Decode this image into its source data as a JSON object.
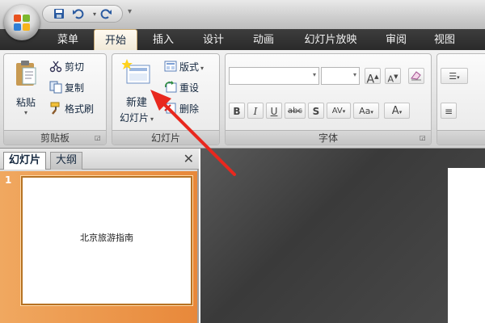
{
  "tabs": [
    "菜单",
    "开始",
    "插入",
    "设计",
    "动画",
    "幻灯片放映",
    "审阅",
    "视图"
  ],
  "active_tab": "开始",
  "clipboard": {
    "paste": "粘贴",
    "cut": "剪切",
    "copy": "复制",
    "format_painter": "格式刷",
    "label": "剪贴板"
  },
  "slides_group": {
    "new_slide_line1": "新建",
    "new_slide_line2": "幻灯片",
    "layout": "版式",
    "reset": "重设",
    "delete": "删除",
    "label": "幻灯片"
  },
  "font_group": {
    "label": "字体",
    "bold": "B",
    "italic": "I",
    "underline": "U",
    "strikethrough": "abc",
    "shadow": "S",
    "spacing": "AV",
    "case": "Aa",
    "color": "A",
    "grow": "A",
    "shrink": "A"
  },
  "panel": {
    "tab_slides": "幻灯片",
    "tab_outline": "大纲",
    "close": "✕"
  },
  "thumbnail": {
    "number": "1",
    "title": "北京旅游指南"
  },
  "colors": {
    "annotation_arrow": "#e8281e",
    "selected_thumbnail": "#e8883a",
    "tab_bar": "#2f2f2f"
  },
  "icons": [
    "office-logo-icon",
    "save-icon",
    "undo-icon",
    "redo-icon",
    "paste-icon",
    "cut-icon",
    "copy-icon",
    "format-painter-icon",
    "new-slide-icon",
    "layout-icon",
    "reset-icon",
    "delete-icon",
    "clear-format-icon",
    "close-icon"
  ]
}
